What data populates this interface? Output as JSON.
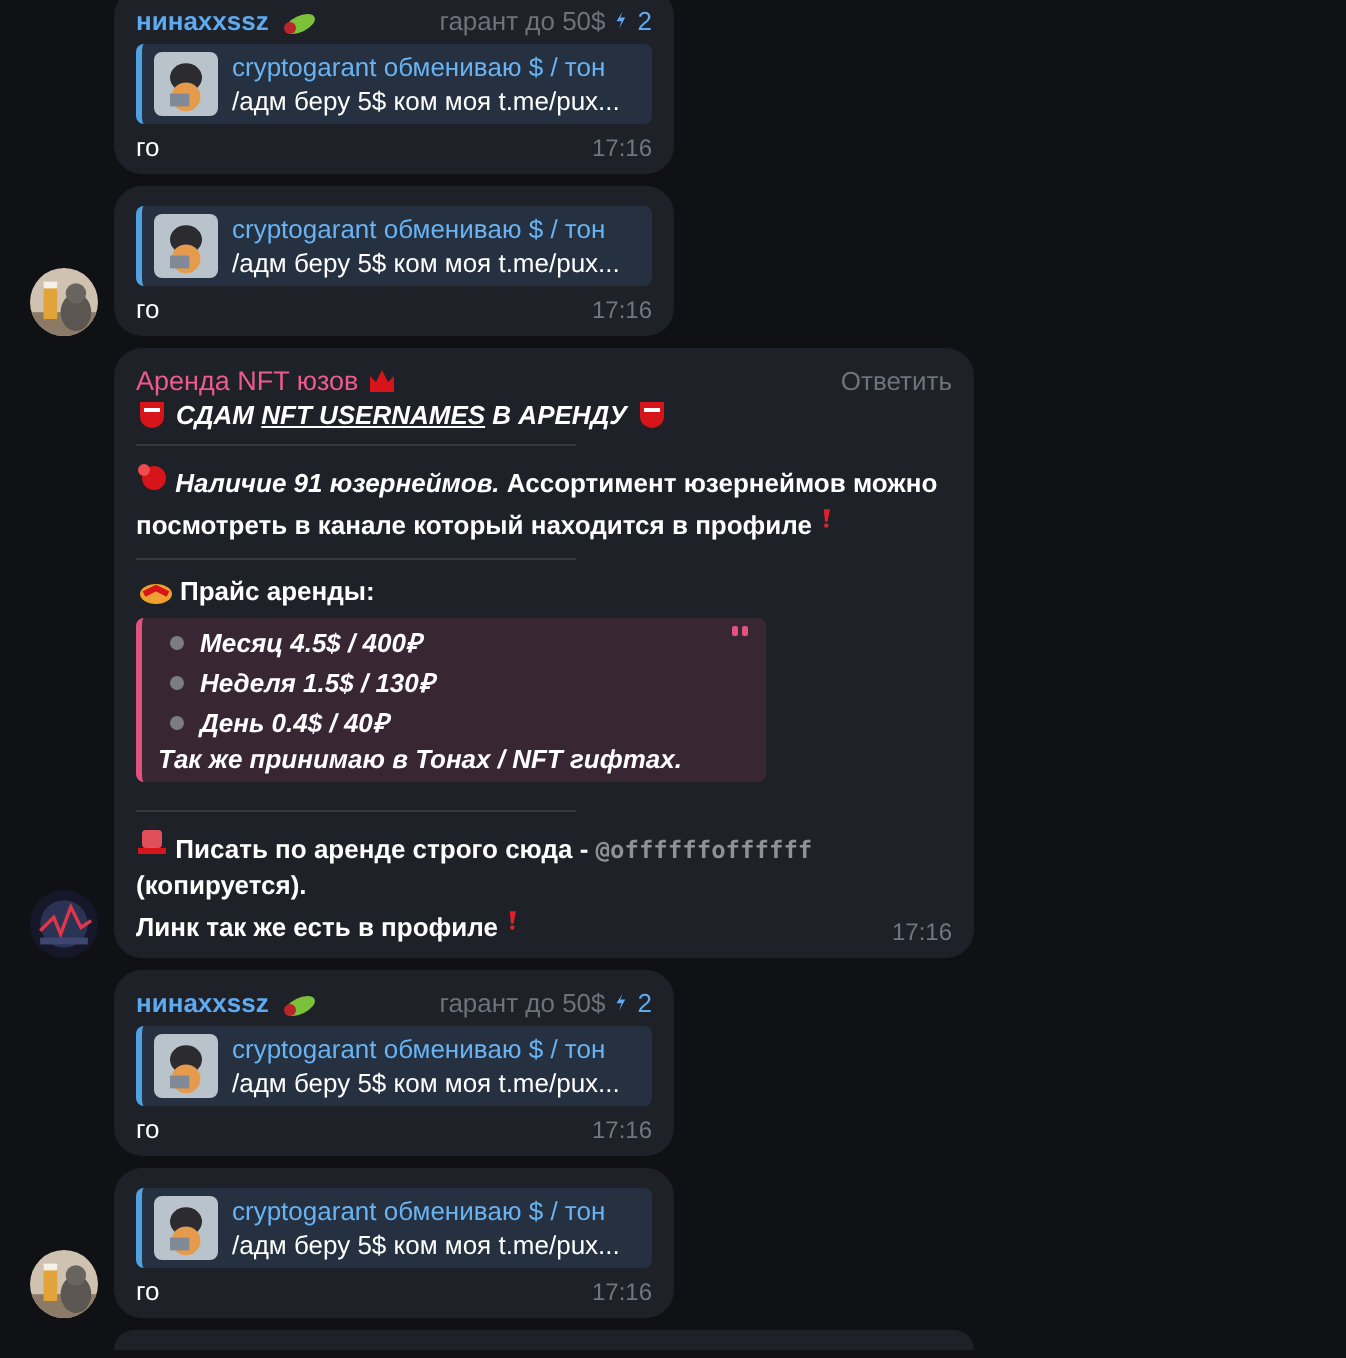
{
  "messages": [
    {
      "kind": "reply",
      "sender": "нинахxssz",
      "badge": "гарант до 50$",
      "boosts": "2",
      "quote_title": "cryptogarant обменивaю $ / тон",
      "quote_text": "/адм беру 5$ ком моя t.me/pux...",
      "text": "го",
      "time": "17:16",
      "avatar": false
    },
    {
      "kind": "reply",
      "quote_title": "cryptogarant обменивaю $ / тон",
      "quote_text": "/адм беру 5$ ком моя t.me/pux...",
      "text": "го",
      "time": "17:16",
      "avatar": true
    },
    {
      "kind": "post",
      "author": "Аренда NFT юзов",
      "action": "Ответить",
      "heading": {
        "before": "СДАМ ",
        "underlined": "NFT USERNAMES",
        "after": " В АРЕНДУ"
      },
      "stock": "*Наличие 91 юзернеймов.* Ассортимент юзернеймов можно посмотреть в канале который находится в профиле",
      "price_title": "Прайс аренды:",
      "prices": [
        "Месяц 4.5$ / 400₽",
        "Неделя 1.5$ / 130₽",
        "День 0.4$ / 40₽"
      ],
      "price_note": "Так же принимаю в Тонах / NFT гифтах.",
      "contact": "Писать по аренде строго сюда - ",
      "handle": "@offffffoffffff",
      "copy_note": "(копируется).",
      "link_note": "Линк так же есть в профиле",
      "time": "17:16",
      "avatar": true
    },
    {
      "kind": "reply",
      "sender": "нинахxssz",
      "badge": "гарант до 50$",
      "boosts": "2",
      "quote_title": "cryptogarant обменивaю $ / тон",
      "quote_text": "/адм беру 5$ ком моя t.me/pux...",
      "text": "го",
      "time": "17:16",
      "avatar": false
    },
    {
      "kind": "reply",
      "quote_title": "cryptogarant обменивaю $ / тон",
      "quote_text": "/адм беру 5$ ком моя t.me/pux...",
      "text": "го",
      "time": "17:16",
      "avatar": true
    },
    {
      "kind": "cut",
      "avatar": false
    }
  ]
}
